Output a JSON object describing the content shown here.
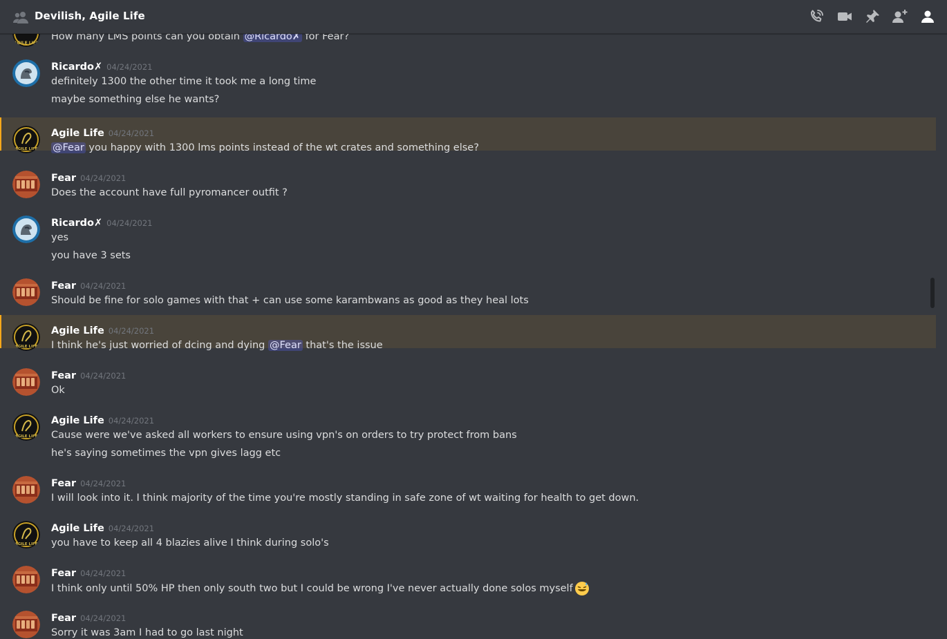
{
  "header": {
    "title": "Devilish, Agile Life",
    "icons": [
      "group-dm-icon",
      "voice-call-icon",
      "video-call-icon",
      "pin-icon",
      "add-friend-icon",
      "member-list-icon"
    ]
  },
  "partial_message": {
    "text_before": "How many LMS points can you obtain ",
    "mention": "@Ricardo✗",
    "text_after": " for Fear?"
  },
  "messages": [
    {
      "author": "Ricardo✗",
      "timestamp": "04/24/2021",
      "avatar": "ricardo",
      "highlight": false,
      "lines": [
        {
          "text": "definitely 1300 the other time it took me a long time"
        },
        {
          "text": "maybe something else he wants?"
        }
      ]
    },
    {
      "author": "Agile Life",
      "timestamp": "04/24/2021",
      "avatar": "agile",
      "highlight": true,
      "lines": [
        {
          "mention": "@Fear",
          "after": " you happy with 1300 lms points instead of the wt crates and something else?"
        }
      ]
    },
    {
      "author": "Fear",
      "timestamp": "04/24/2021",
      "avatar": "fear",
      "highlight": false,
      "lines": [
        {
          "text": "Does the account have full pyromancer outfit ?"
        }
      ]
    },
    {
      "author": "Ricardo✗",
      "timestamp": "04/24/2021",
      "avatar": "ricardo",
      "highlight": false,
      "lines": [
        {
          "text": "yes"
        },
        {
          "text": "you have 3 sets"
        }
      ]
    },
    {
      "author": "Fear",
      "timestamp": "04/24/2021",
      "avatar": "fear",
      "highlight": false,
      "lines": [
        {
          "text": "Should be fine for solo games with that + can use some karambwans as good as they heal lots"
        }
      ]
    },
    {
      "author": "Agile Life",
      "timestamp": "04/24/2021",
      "avatar": "agile",
      "highlight": true,
      "lines": [
        {
          "text": "I think he's just worried of dcing and dying ",
          "mention": "@Fear",
          "after": " that's the issue"
        }
      ]
    },
    {
      "author": "Fear",
      "timestamp": "04/24/2021",
      "avatar": "fear",
      "highlight": false,
      "lines": [
        {
          "text": "Ok"
        }
      ]
    },
    {
      "author": "Agile Life",
      "timestamp": "04/24/2021",
      "avatar": "agile",
      "highlight": false,
      "lines": [
        {
          "text": "Cause were we've asked all workers to ensure using vpn's on orders to try protect from bans"
        },
        {
          "text": "he's saying sometimes the vpn gives lagg etc"
        }
      ]
    },
    {
      "author": "Fear",
      "timestamp": "04/24/2021",
      "avatar": "fear",
      "highlight": false,
      "lines": [
        {
          "text": "I will look into it. I think majority of the time you're mostly standing in safe zone of wt waiting for health to get down."
        }
      ]
    },
    {
      "author": "Agile Life",
      "timestamp": "04/24/2021",
      "avatar": "agile",
      "highlight": false,
      "lines": [
        {
          "text": "you have to keep all 4 blazies alive I think during solo's"
        }
      ]
    },
    {
      "author": "Fear",
      "timestamp": "04/24/2021",
      "avatar": "fear",
      "highlight": false,
      "lines": [
        {
          "text": "I think only until 50% HP then only south two but I could be wrong I've never actually done solos myself",
          "emoji": "sweat-smile-emoji"
        }
      ]
    },
    {
      "author": "Fear",
      "timestamp": "04/24/2021",
      "avatar": "fear",
      "highlight": false,
      "lines": [
        {
          "text": "Sorry it was 3am I had to go last night"
        }
      ]
    }
  ],
  "colors": {
    "background": "#36393f",
    "highlight_bg": "rgba(250,168,26,0.1)",
    "highlight_bar": "#faa81a",
    "mention_bg": "rgba(88,101,242,0.3)",
    "timestamp": "#72767d"
  }
}
